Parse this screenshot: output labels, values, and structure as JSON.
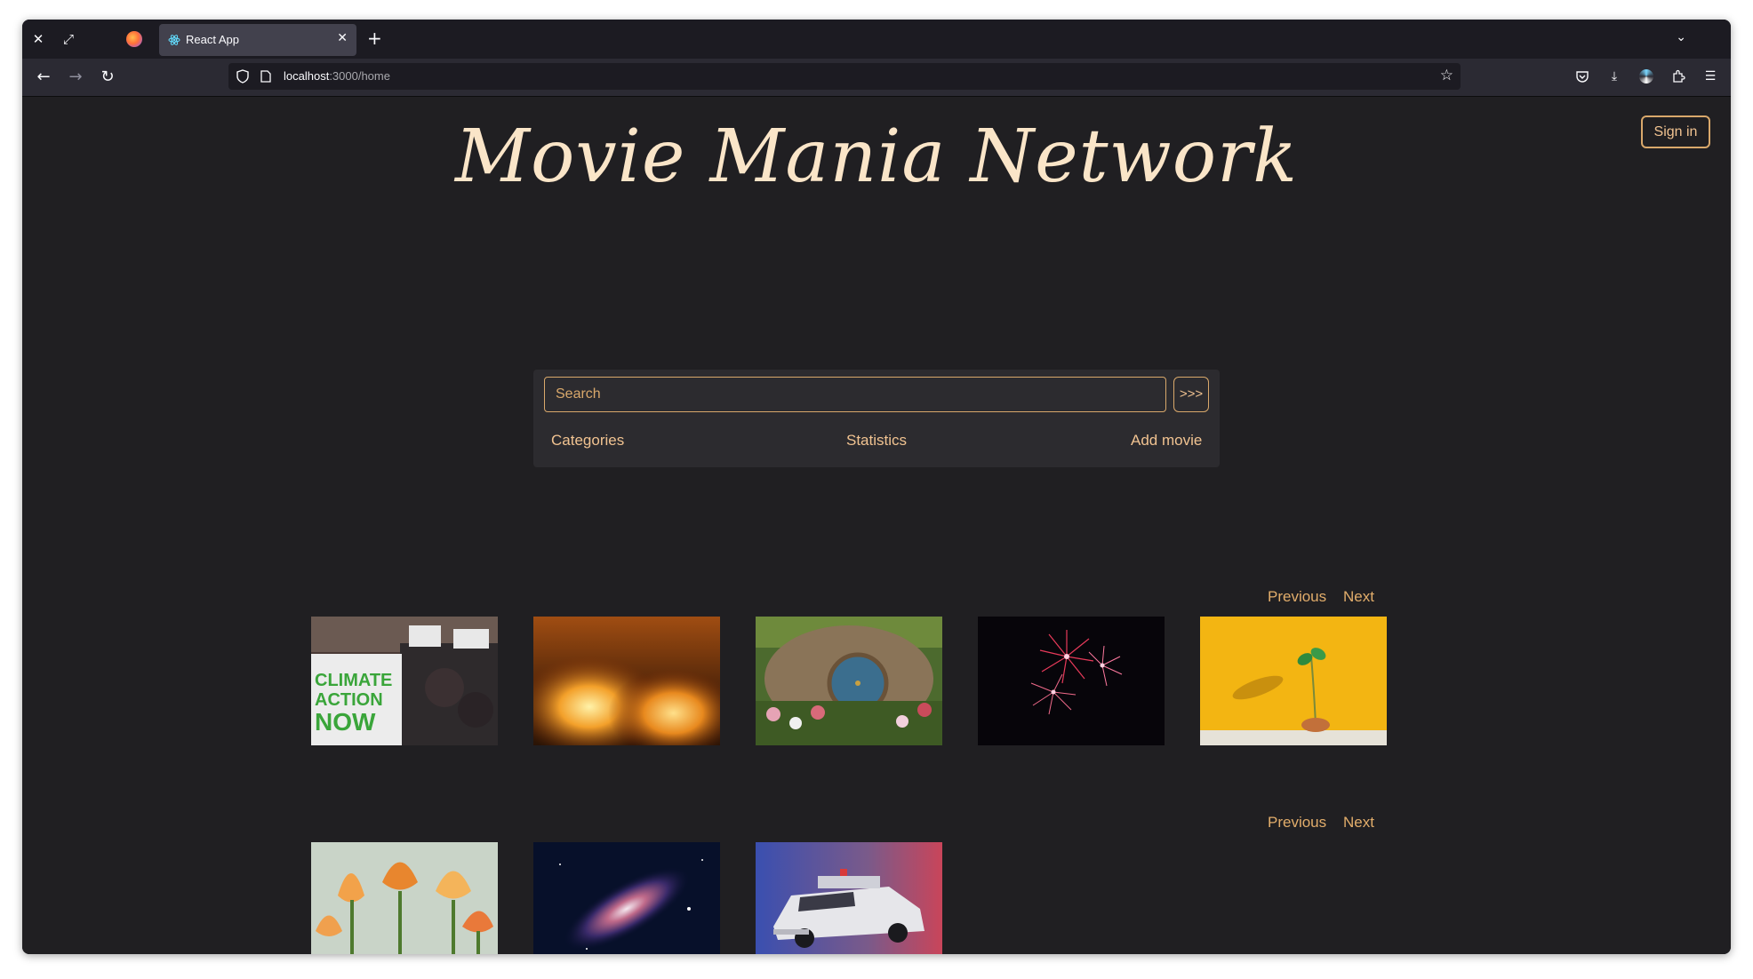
{
  "browser": {
    "tab_title": "React App",
    "url_host": "localhost",
    "url_path": ":3000/home"
  },
  "header": {
    "sign_in_label": "Sign in",
    "site_title": "Movie Mania Network"
  },
  "search": {
    "placeholder": "Search",
    "go_label": ">>>"
  },
  "menu": {
    "categories": "Categories",
    "statistics": "Statistics",
    "add_movie": "Add movie"
  },
  "rows": [
    {
      "previous_label": "Previous",
      "next_label": "Next",
      "movies": [
        "climate-protest-image",
        "fire-explosion-image",
        "hobbit-door-image",
        "fireworks-image",
        "sprout-on-yellow-image"
      ]
    },
    {
      "previous_label": "Previous",
      "next_label": "Next",
      "movies": [
        "tulips-image",
        "galaxy-image",
        "ecto-car-image"
      ]
    }
  ],
  "colors": {
    "accent": "#d9a86b",
    "page_bg": "#201f22",
    "title": "#fae5c8"
  }
}
